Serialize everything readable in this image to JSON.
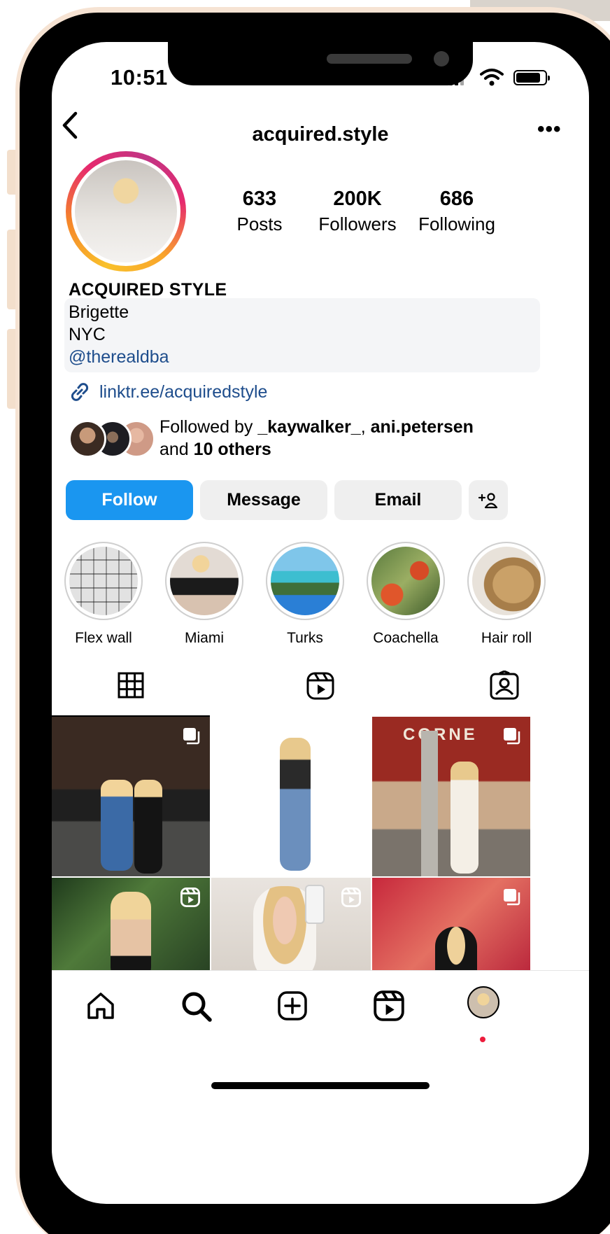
{
  "status_bar": {
    "time": "10:51"
  },
  "header": {
    "username": "acquired.style",
    "back_icon": "chevron-left-icon",
    "more_icon": "ellipsis-icon"
  },
  "stats": [
    {
      "value": "633",
      "label": "Posts"
    },
    {
      "value": "200K",
      "label": "Followers"
    },
    {
      "value": "686",
      "label": "Following"
    }
  ],
  "bio": {
    "name": "ACQUIRED STYLE",
    "line1": "Brigette",
    "line2": "NYC",
    "mention": "@therealdba",
    "link": "linktr.ee/acquiredstyle"
  },
  "followed_by": {
    "prefix": "Followed by ",
    "user1": "_kaywalker_",
    "separator": ", ",
    "user2": "ani.petersen",
    "and_text": "and ",
    "others": "10 others"
  },
  "actions": {
    "follow": "Follow",
    "message": "Message",
    "email": "Email",
    "add_user_icon": "add-person-icon"
  },
  "highlights": [
    {
      "label": "Flex wall"
    },
    {
      "label": "Miami"
    },
    {
      "label": "Turks"
    },
    {
      "label": "Coachella"
    },
    {
      "label": "Hair roll"
    }
  ],
  "tabs": [
    {
      "name": "grid",
      "icon": "grid-icon",
      "active": true
    },
    {
      "name": "reels",
      "icon": "reels-icon",
      "active": false
    },
    {
      "name": "tagged",
      "icon": "tagged-icon",
      "active": false
    }
  ],
  "posts": [
    {
      "type": "carousel"
    },
    {
      "type": "reel"
    },
    {
      "type": "carousel"
    },
    {
      "type": "reel"
    },
    {
      "type": "reel"
    },
    {
      "type": "carousel"
    }
  ],
  "post_signage": "CORNE",
  "bottom_nav": [
    "home-icon",
    "search-icon",
    "create-icon",
    "reels-icon",
    "profile-avatar"
  ],
  "colors": {
    "follow_button": "#1a96f0",
    "link": "#1e4d8c",
    "secondary_button": "#efefef",
    "notification_dot": "#ed1c3c"
  }
}
